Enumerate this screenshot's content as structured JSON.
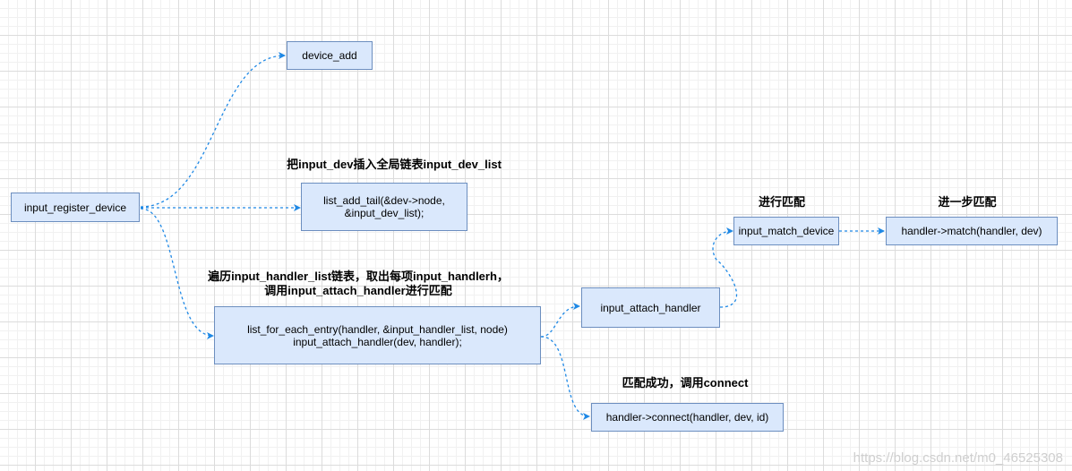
{
  "nodes": {
    "input_register_device": "input_register_device",
    "device_add": "device_add",
    "list_add_tail": "list_add_tail(&dev->node,\n&input_dev_list);",
    "list_for_each_entry": "list_for_each_entry(handler, &input_handler_list, node)\ninput_attach_handler(dev, handler);",
    "input_attach_handler": "input_attach_handler",
    "input_match_device": "input_match_device",
    "handler_match": "handler->match(handler, dev)",
    "handler_connect": "handler->connect(handler, dev, id)"
  },
  "labels": {
    "insert_list": "把input_dev插入全局链表input_dev_list",
    "traverse": "遍历input_handler_list链表，取出每项input_handlerh，\n调用input_attach_handler进行匹配",
    "match": "进行匹配",
    "further_match": "进一步匹配",
    "match_success": "匹配成功，调用connect"
  },
  "watermark": "https://blog.csdn.net/m0_46525308",
  "colors": {
    "node_fill": "#dae8fc",
    "node_border": "#6c8ebf",
    "edge": "#1e88e5"
  }
}
